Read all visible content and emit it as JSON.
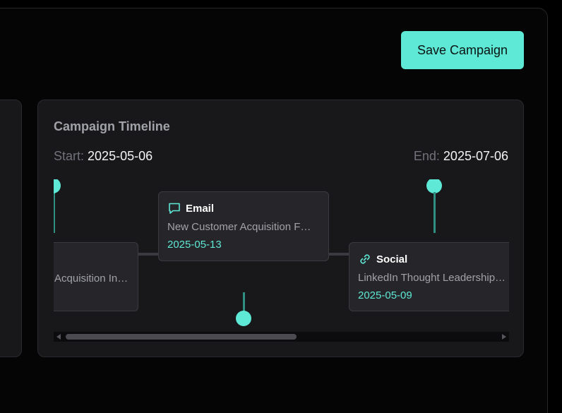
{
  "toolbar": {
    "save_label": "Save Campaign"
  },
  "timeline": {
    "title": "Campaign Timeline",
    "start_label": "Start:",
    "start_value": "2025-05-06",
    "end_label": "End:",
    "end_value": "2025-07-06",
    "events": [
      {
        "type": "",
        "name": "Acquisition In…",
        "date": "",
        "icon": ""
      },
      {
        "type": "Email",
        "name": "New Customer Acquisition F…",
        "date": "2025-05-13",
        "icon": "chat-bubble-icon"
      },
      {
        "type": "Social",
        "name": "LinkedIn Thought Leadership…",
        "date": "2025-05-09",
        "icon": "link-icon"
      }
    ]
  },
  "colors": {
    "accent": "#5ee8d6",
    "card": "#18181b",
    "event_card": "#26262a"
  }
}
